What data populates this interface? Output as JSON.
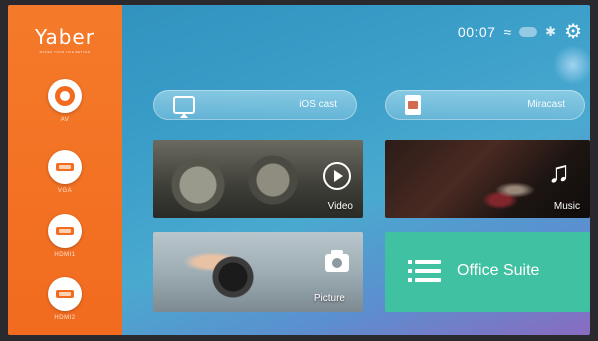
{
  "brand": {
    "logo": "Yaber",
    "tagline": "MAKES YOUR LIFE BETTER"
  },
  "sidebar": {
    "items": [
      {
        "label": "AV"
      },
      {
        "label": "VGA"
      },
      {
        "label": "HDMI1"
      },
      {
        "label": "HDMI2"
      }
    ]
  },
  "status": {
    "time": "00:07",
    "icons": [
      "wifi-icon",
      "network-icon",
      "bluetooth-icon",
      "gear-icon"
    ]
  },
  "pills": {
    "ios_cast": {
      "label": "iOS cast",
      "icon": "screen-mirror-icon"
    },
    "miracast": {
      "label": "Miracast",
      "icon": "cast-icon"
    }
  },
  "tiles": {
    "video": {
      "label": "Video",
      "icon": "play-icon"
    },
    "music": {
      "label": "Music",
      "icon": "music-note-icon"
    },
    "picture": {
      "label": "Picture",
      "icon": "camera-icon"
    },
    "office": {
      "label": "Office Suite",
      "icon": "list-icon",
      "color": "#3fc1a2"
    }
  },
  "colors": {
    "sidebar": "#f26b1f",
    "office": "#3fc1a2"
  }
}
